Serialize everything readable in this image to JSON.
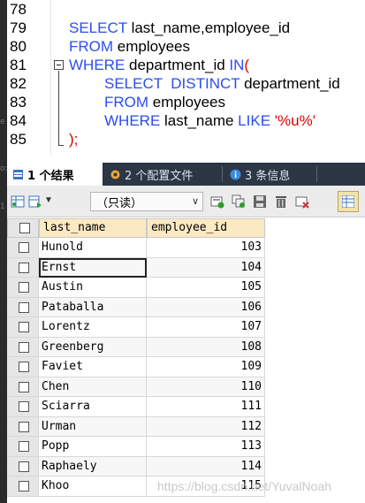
{
  "editor": {
    "lines": [
      {
        "num": "78",
        "tokens": []
      },
      {
        "num": "79",
        "tokens": [
          {
            "t": "SELECT ",
            "c": "kw"
          },
          {
            "t": "last_name,employee_id",
            "c": "id"
          }
        ]
      },
      {
        "num": "80",
        "tokens": [
          {
            "t": "FROM ",
            "c": "kw"
          },
          {
            "t": "employees",
            "c": "id"
          }
        ]
      },
      {
        "num": "81",
        "tokens": [
          {
            "t": "WHERE ",
            "c": "kw"
          },
          {
            "t": "department_id ",
            "c": "id"
          },
          {
            "t": "IN",
            "c": "kw"
          },
          {
            "t": "(",
            "c": "punc"
          }
        ]
      },
      {
        "num": "82",
        "tokens": [
          {
            "t": "SELECT  DISTINCT ",
            "c": "kw"
          },
          {
            "t": "department_id",
            "c": "id"
          }
        ]
      },
      {
        "num": "83",
        "tokens": [
          {
            "t": "FROM ",
            "c": "kw"
          },
          {
            "t": "employees",
            "c": "id"
          }
        ]
      },
      {
        "num": "84",
        "tokens": [
          {
            "t": "WHERE ",
            "c": "kw"
          },
          {
            "t": "last_name ",
            "c": "id"
          },
          {
            "t": "LIKE ",
            "c": "kw"
          },
          {
            "t": "'%u%'",
            "c": "str"
          }
        ]
      },
      {
        "num": "85",
        "tokens": [
          {
            "t": ");",
            "c": "punc"
          }
        ]
      }
    ]
  },
  "tabs": [
    {
      "label": "1 个结果",
      "icon": "result-table-icon",
      "active": true
    },
    {
      "label": "2 个配置文件",
      "icon": "profile-icon",
      "active": false
    },
    {
      "label": "3 条信息",
      "icon": "info-icon",
      "active": false
    }
  ],
  "toolbar": {
    "mode_select": "（只读）"
  },
  "grid": {
    "columns": [
      "last_name",
      "employee_id"
    ],
    "rows": [
      [
        "Hunold",
        "103"
      ],
      [
        "Ernst",
        "104"
      ],
      [
        "Austin",
        "105"
      ],
      [
        "Pataballa",
        "106"
      ],
      [
        "Lorentz",
        "107"
      ],
      [
        "Greenberg",
        "108"
      ],
      [
        "Faviet",
        "109"
      ],
      [
        "Chen",
        "110"
      ],
      [
        "Sciarra",
        "111"
      ],
      [
        "Urman",
        "112"
      ],
      [
        "Popp",
        "113"
      ],
      [
        "Raphaely",
        "114"
      ],
      [
        "Khoo",
        "115"
      ]
    ],
    "selected_row": 1
  },
  "watermark": "https://blog.csdn.net/YuvalNoah",
  "colors": {
    "keyword": "#2b4cf2",
    "string": "#e00000",
    "tabbar": "#2c3645",
    "header": "#fbe9c3"
  }
}
